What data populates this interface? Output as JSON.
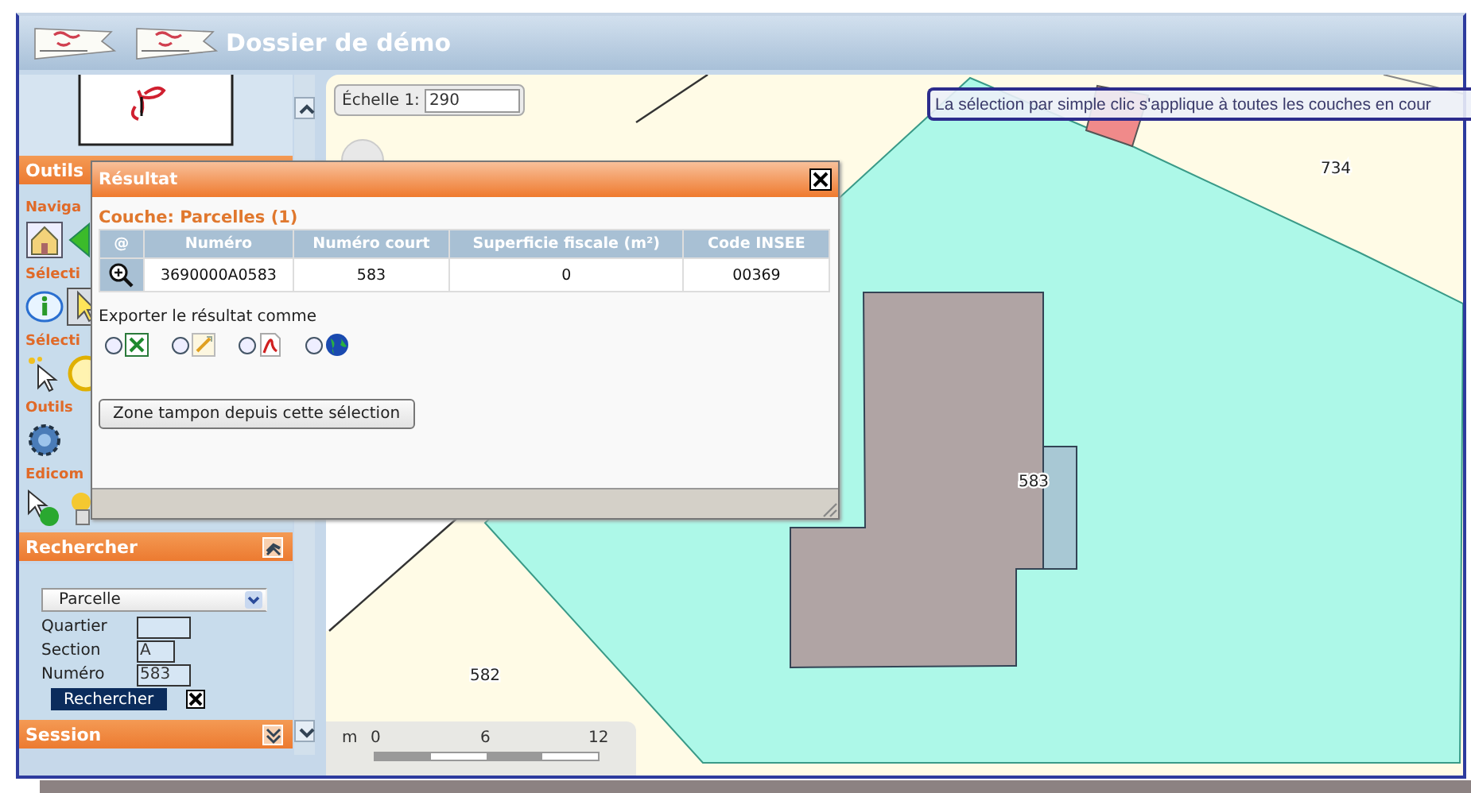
{
  "header": {
    "title": "Dossier de démo"
  },
  "sidebar": {
    "tools_header": "Outils",
    "groups": [
      {
        "title": "Naviga"
      },
      {
        "title": "Sélecti"
      },
      {
        "title": "Sélecti"
      },
      {
        "title": "Outils"
      },
      {
        "title": "Edicom"
      }
    ],
    "search": {
      "title": "Rechercher",
      "type": "Parcelle",
      "fields": [
        {
          "label": "Quartier"
        },
        {
          "label": "Section",
          "value": "A"
        },
        {
          "label": "Numéro",
          "value": "583"
        }
      ],
      "button": "Rechercher"
    },
    "session": {
      "title": "Session"
    }
  },
  "map": {
    "scale_label": "Échelle 1:",
    "scale_value": "290",
    "tooltip": "La sélection par simple clic s'applique à toutes les couches en cour",
    "labels": [
      {
        "text": "734"
      },
      {
        "text": "583"
      },
      {
        "text": "582"
      }
    ],
    "scalebar": {
      "unit": "m",
      "ticks": [
        "0",
        "6",
        "12"
      ]
    }
  },
  "dialog": {
    "title": "Résultat",
    "layer": "Couche: Parcelles (1)",
    "table": {
      "columns": [
        "@",
        "Numéro",
        "Numéro court",
        "Superficie fiscale (m²)",
        "Code INSEE"
      ],
      "rows": [
        [
          "",
          "3690000A0583",
          "583",
          "0",
          "00369"
        ]
      ]
    },
    "export_label": "Exporter le résultat comme",
    "export_options": [
      {
        "selected": false
      },
      {
        "selected": false
      },
      {
        "selected": false
      },
      {
        "selected": false
      }
    ],
    "buffer_button": "Zone tampon depuis cette sélection"
  }
}
